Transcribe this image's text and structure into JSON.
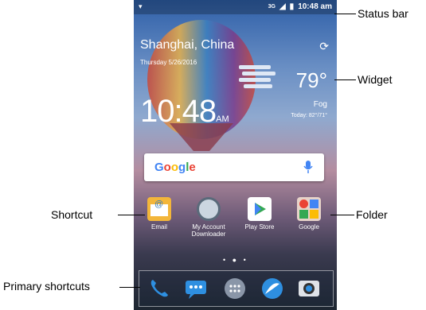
{
  "status": {
    "signal": "3G",
    "time": "10:48 am"
  },
  "weather": {
    "city": "Shanghai, China",
    "date": "Thursday 5/26/2016",
    "temp": "79°",
    "condition": "Fog",
    "today": "Today: 82°/71°"
  },
  "clock": {
    "time": "10:48",
    "ampm": "AM"
  },
  "search": {
    "logo": "Google"
  },
  "apps": [
    {
      "label": "Email",
      "icon": "email-icon"
    },
    {
      "label": "My Account Downloader",
      "icon": "account-downloader-icon"
    },
    {
      "label": "Play Store",
      "icon": "play-store-icon"
    },
    {
      "label": "Google",
      "icon": "google-folder-icon"
    }
  ],
  "dock": [
    {
      "icon": "phone-icon"
    },
    {
      "icon": "messages-icon"
    },
    {
      "icon": "app-drawer-icon"
    },
    {
      "icon": "browser-icon"
    },
    {
      "icon": "camera-icon"
    }
  ],
  "annotations": {
    "status_bar": "Status bar",
    "widget": "Widget",
    "shortcut": "Shortcut",
    "folder": "Folder",
    "primary": "Primary shortcuts"
  },
  "colors": {
    "accent": "#4a90d9",
    "google_blue": "#4285f4",
    "google_red": "#ea4335",
    "google_yellow": "#fbbc05",
    "google_green": "#34a853"
  }
}
